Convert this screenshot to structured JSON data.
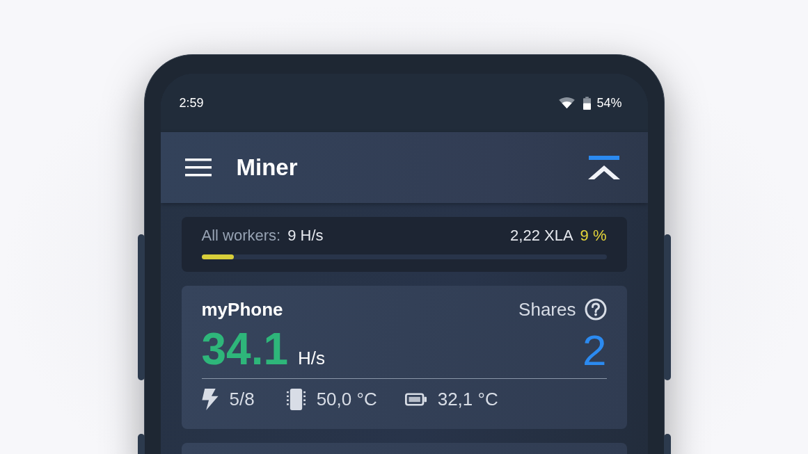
{
  "status_bar": {
    "time": "2:59",
    "battery": "54%"
  },
  "app_bar": {
    "title": "Miner"
  },
  "summary": {
    "label": "All workers:",
    "hashrate": "9 H/s",
    "balance": "2,22 XLA",
    "percent": "9 %",
    "level": 0.08
  },
  "workers": [
    {
      "name": "myPhone",
      "shares_label": "Shares",
      "hashrate": "34.1",
      "unit": "H/s",
      "shares": "2",
      "threads": "5/8",
      "cpu_temp": "50,0 °C",
      "battery_temp": "32,1 °C"
    }
  ]
}
